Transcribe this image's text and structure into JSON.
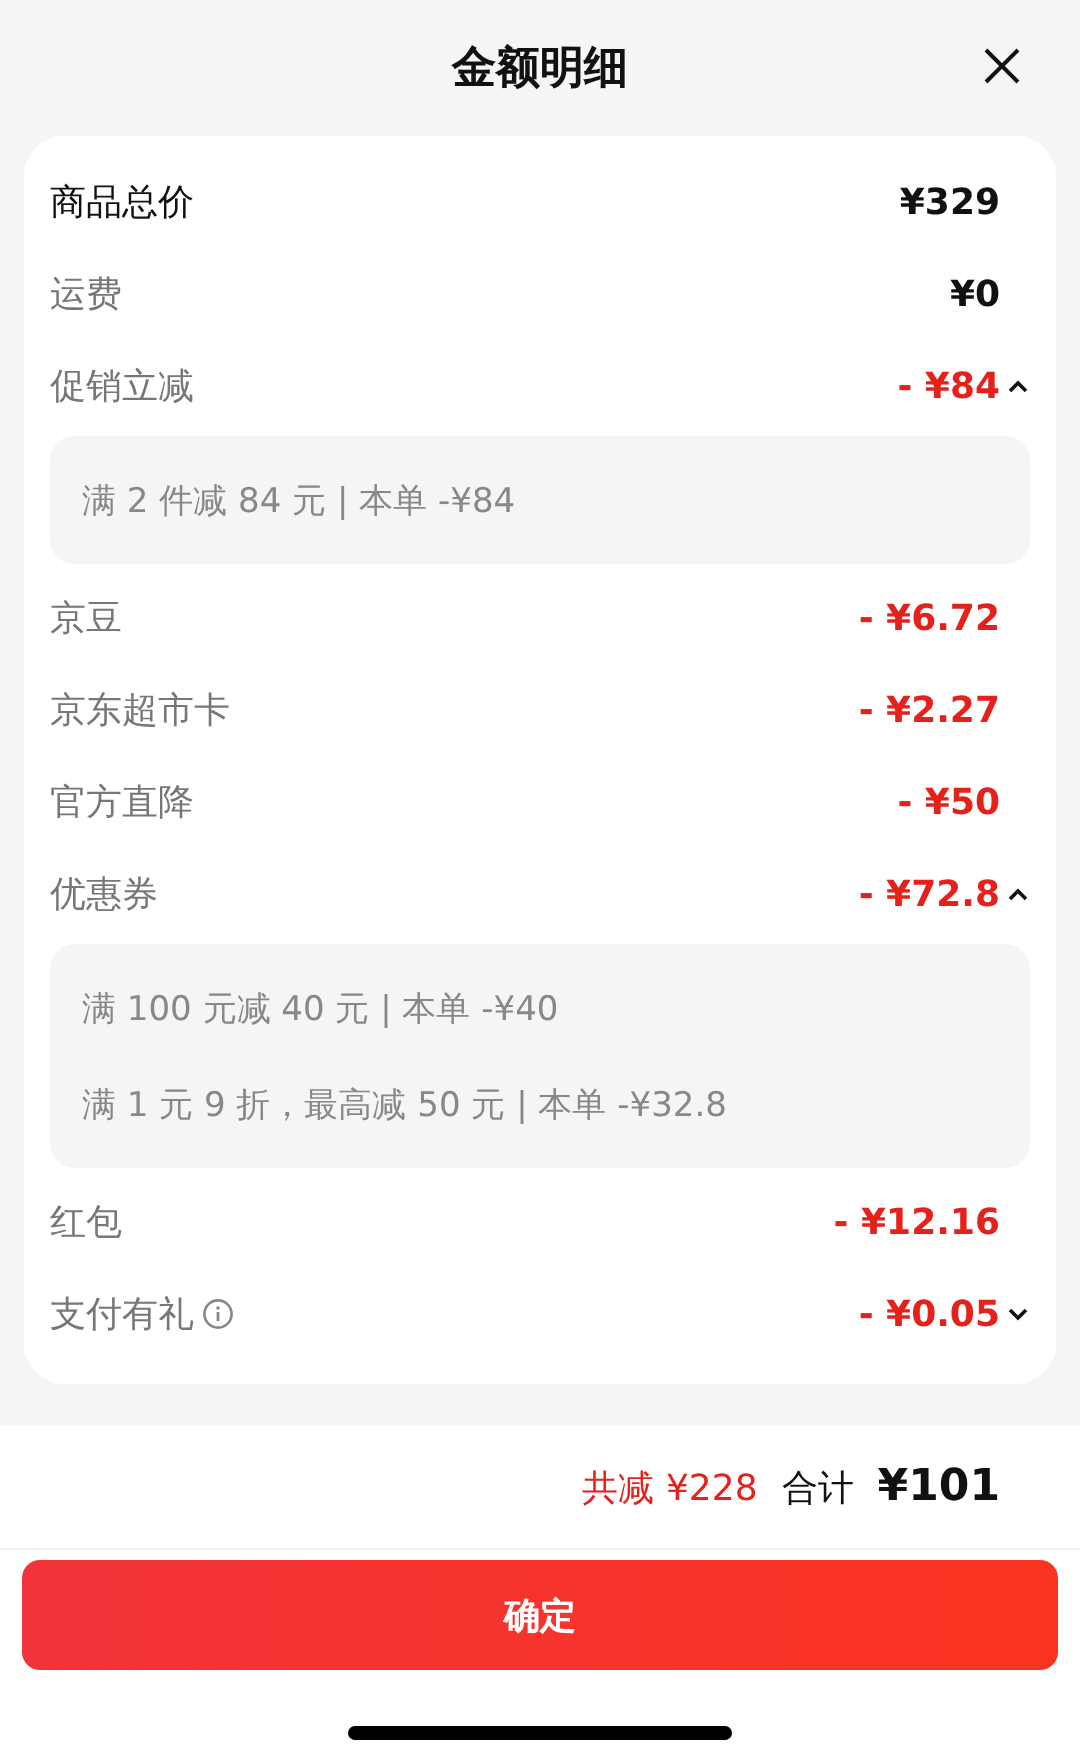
{
  "header": {
    "title": "金额明细"
  },
  "rows": [
    {
      "kind": "total",
      "label": "商品总价",
      "value": "¥329"
    },
    {
      "kind": "plain",
      "label": "运费",
      "value": "¥0"
    },
    {
      "kind": "discount",
      "label": "促销立减",
      "value": "- ¥84",
      "expanded": true,
      "details": [
        "满 2 件减 84 元 | 本单 -¥84"
      ]
    },
    {
      "kind": "discount",
      "label": "京豆",
      "value": "- ¥6.72"
    },
    {
      "kind": "discount",
      "label": "京东超市卡",
      "value": "- ¥2.27"
    },
    {
      "kind": "discount",
      "label": "官方直降",
      "value": "- ¥50"
    },
    {
      "kind": "discount",
      "label": "优惠券",
      "value": "- ¥72.8",
      "expanded": true,
      "details": [
        "满 100 元减 40 元 | 本单 -¥40",
        "满 1 元 9 折，最高减 50 元 | 本单 -¥32.8"
      ]
    },
    {
      "kind": "discount",
      "label": "红包",
      "value": "- ¥12.16"
    },
    {
      "kind": "discount",
      "label": "支付有礼",
      "value": "- ¥0.05",
      "info": true,
      "expanded": false
    }
  ],
  "summary": {
    "saved": "共减 ¥228",
    "total_label": "合计",
    "total_value": "¥101"
  },
  "confirm_button": "确定"
}
